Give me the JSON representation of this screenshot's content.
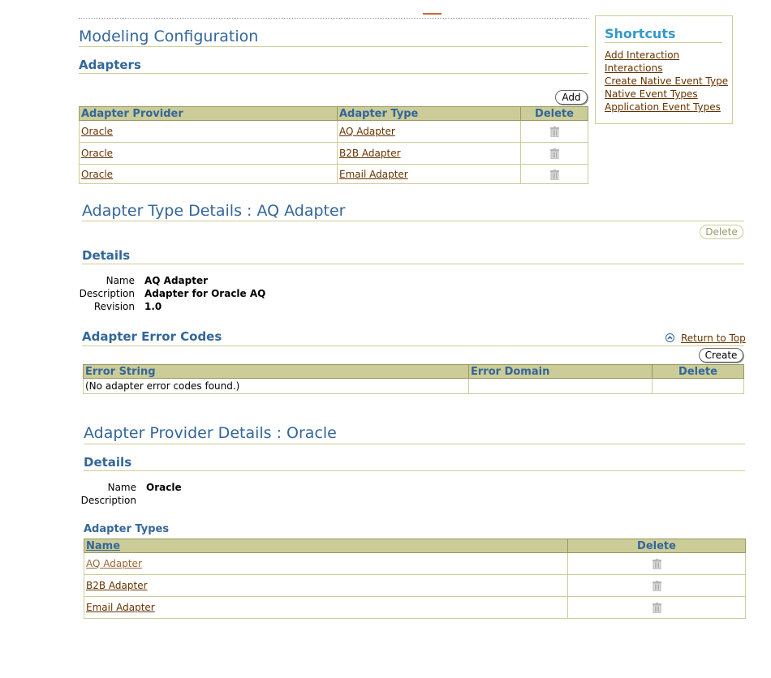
{
  "page": {
    "title": "Modeling Configuration"
  },
  "adapters": {
    "heading": "Adapters",
    "add_label": "Add",
    "columns": [
      "Adapter Provider",
      "Adapter Type",
      "Delete"
    ],
    "rows": [
      {
        "provider": "Oracle",
        "type": "AQ Adapter"
      },
      {
        "provider": "Oracle",
        "type": "B2B Adapter"
      },
      {
        "provider": "Oracle",
        "type": "Email Adapter"
      }
    ]
  },
  "shortcuts": {
    "title": "Shortcuts",
    "items": [
      "Add Interaction",
      "Interactions",
      "Create Native Event Type",
      "Native Event Types",
      "Application Event Types"
    ]
  },
  "adapter_type_details": {
    "title": "Adapter Type Details : AQ Adapter",
    "delete_label": "Delete",
    "details_heading": "Details",
    "fields": [
      {
        "label": "Name",
        "value": "AQ Adapter"
      },
      {
        "label": "Description",
        "value": "Adapter for Oracle AQ"
      },
      {
        "label": "Revision",
        "value": "1.0"
      }
    ],
    "error_codes": {
      "heading": "Adapter Error Codes",
      "return_to_top": "Return to Top",
      "create_label": "Create",
      "columns": [
        "Error String",
        "Error Domain",
        "Delete"
      ],
      "empty_message": "(No adapter error codes found.)"
    }
  },
  "adapter_provider_details": {
    "title": "Adapter Provider Details : Oracle",
    "details_heading": "Details",
    "fields": [
      {
        "label": "Name",
        "value": "Oracle"
      },
      {
        "label": "Description",
        "value": ""
      }
    ],
    "adapter_types": {
      "heading": "Adapter Types",
      "columns": [
        "Name",
        "Delete"
      ],
      "rows": [
        "AQ Adapter",
        "B2B Adapter",
        "Email Adapter"
      ]
    }
  },
  "colors": {
    "heading": "#336699",
    "table_header_bg": "#cccc99",
    "link": "#663300",
    "shortcut_title": "#3399cc"
  },
  "icons": {
    "delete": "trash-icon",
    "return_to_top": "up-arrow-icon"
  }
}
